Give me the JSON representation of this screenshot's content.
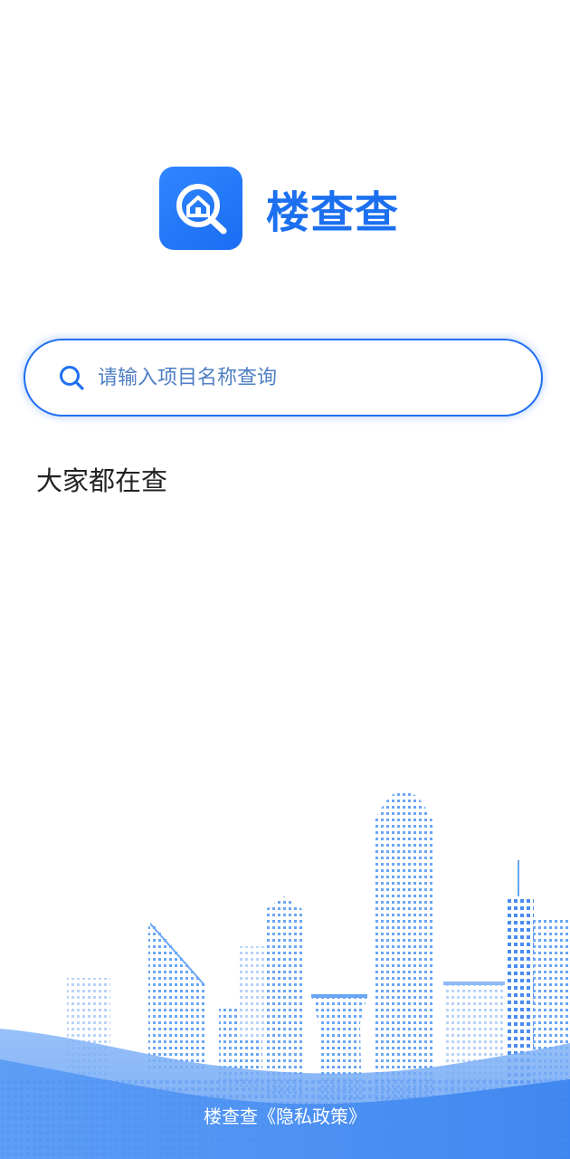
{
  "app": {
    "name": "楼查查"
  },
  "search": {
    "placeholder": "请输入项目名称查询"
  },
  "section": {
    "popular_title": "大家都在查"
  },
  "footer": {
    "brand": "楼查查",
    "privacy_policy": "《隐私政策》"
  },
  "colors": {
    "accent": "#1c70f0",
    "search_border": "#1f6ff2",
    "city_blue": "#4a93f5"
  },
  "icons": {
    "logo": "house-search-icon",
    "search": "search-icon"
  }
}
